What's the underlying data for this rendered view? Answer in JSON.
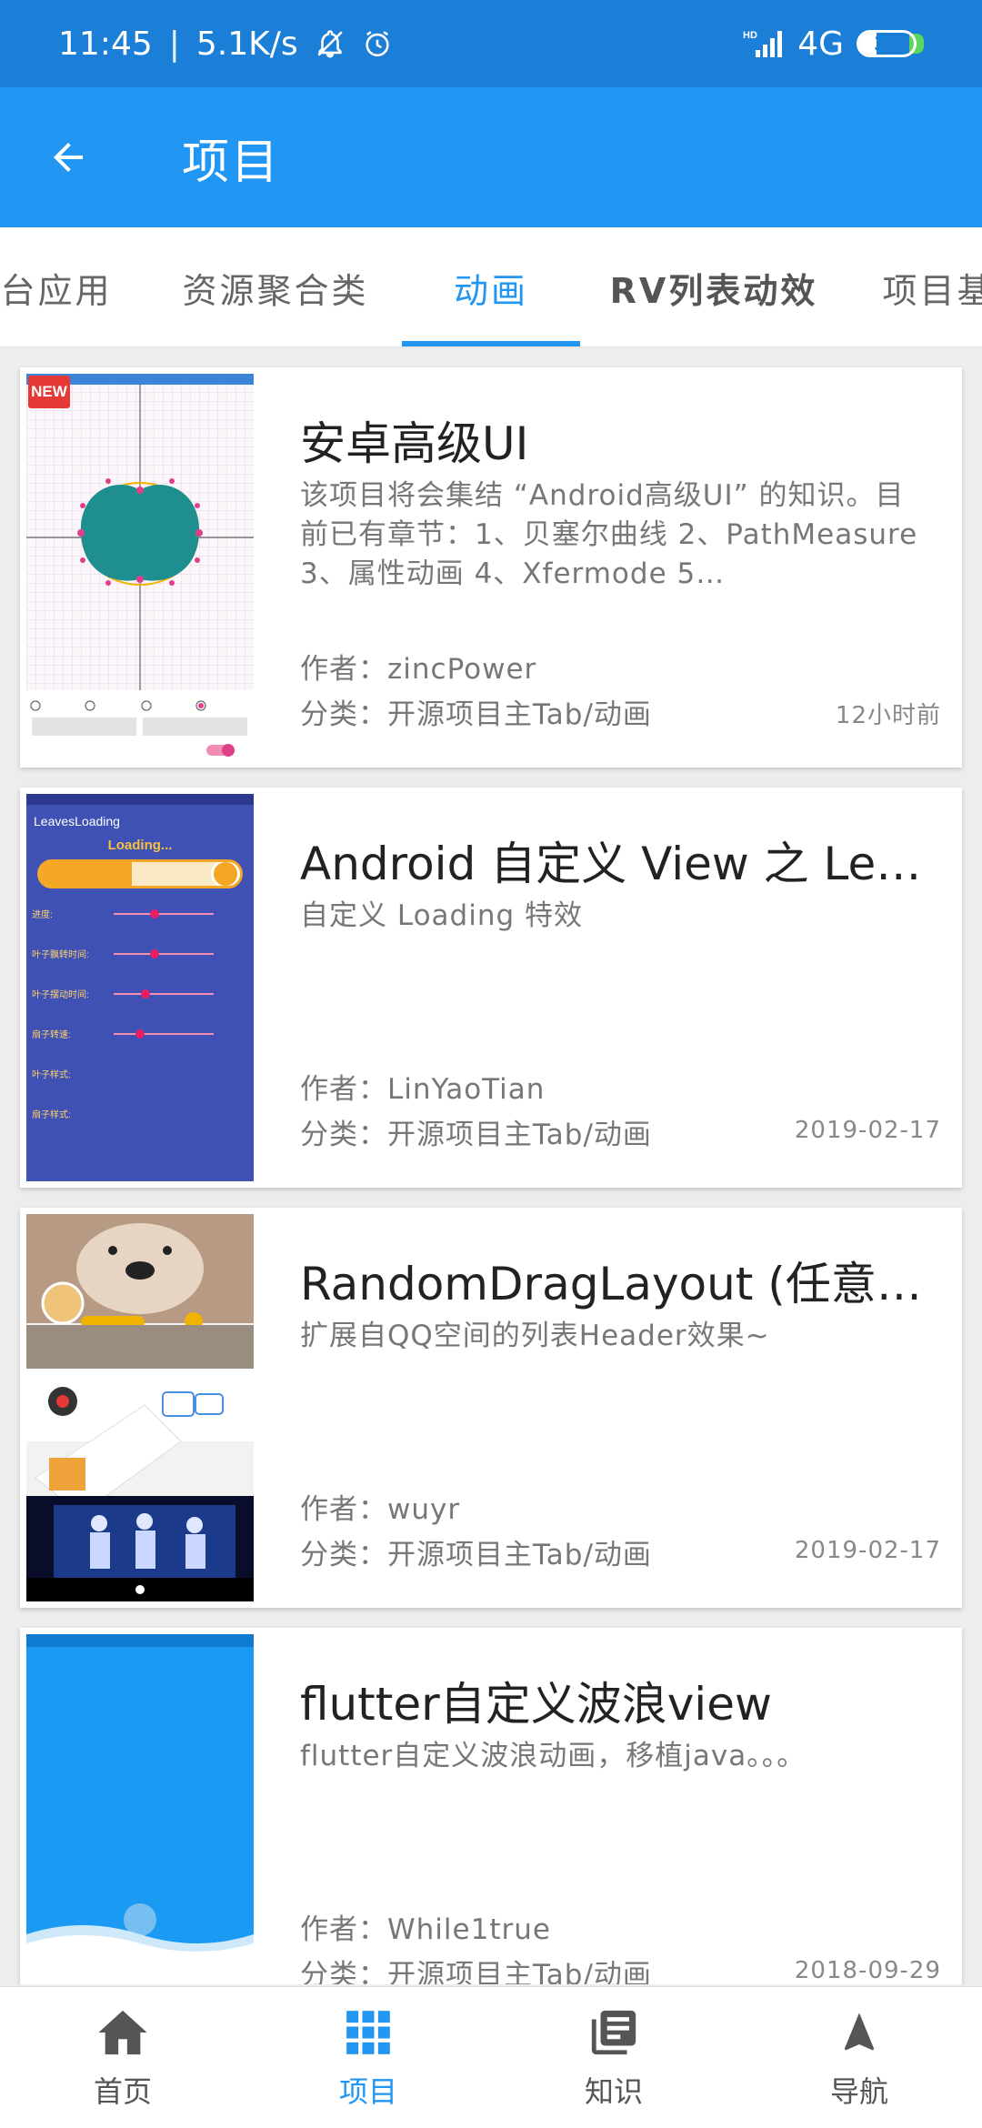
{
  "status_bar": {
    "time": "11:45",
    "speed": "5.1K/s",
    "network": "4G",
    "signal_label": "HD",
    "battery": "31",
    "battery_level": 0.31
  },
  "app_bar": {
    "title": "项目"
  },
  "tabs": [
    {
      "label": "台应用",
      "active": false
    },
    {
      "label": "资源聚合类",
      "active": false
    },
    {
      "label": "动画",
      "active": true
    },
    {
      "label": "RV列表动效",
      "active": false
    },
    {
      "label": "项目基",
      "active": false
    }
  ],
  "projects": [
    {
      "title": "安卓高级UI",
      "desc": "该项目将会集结 “Android高级UI” 的知识。目前已有章节：1、贝塞尔曲线 2、PathMeasure 3、属性动画 4、Xfermode 5…",
      "author": "作者：zincPower",
      "category": "分类：开源项目主Tab/动画",
      "time": "12小时前",
      "is_new": true,
      "new_label": "NEW"
    },
    {
      "title": "Android 自定义 View 之 LeavesLoading",
      "desc": "自定义 Loading 特效",
      "author": "作者：LinYaoTian",
      "category": "分类：开源项目主Tab/动画",
      "time": "2019-02-17",
      "is_new": false,
      "thumb_title": "LeavesLoading",
      "thumb_loading": "Loading...",
      "thumb_rows": [
        "进度:",
        "叶子飘转时间:",
        "叶子摆动时间:",
        "扇子转速:",
        "叶子样式:",
        "扇子样式:"
      ]
    },
    {
      "title": "RandomDragLayout (任意拖拽布局)",
      "desc": "扩展自QQ空间的列表Header效果~",
      "author": "作者：wuyr",
      "category": "分类：开源项目主Tab/动画",
      "time": "2019-02-17",
      "is_new": false
    },
    {
      "title": "flutter自定义波浪view",
      "desc": "flutter自定义波浪动画，移植java。。。",
      "author": "作者：While1true",
      "category": "分类：开源项目主Tab/动画",
      "time": "2018-09-29",
      "is_new": false
    }
  ],
  "bottom_nav": [
    {
      "label": "首页",
      "icon": "home-icon",
      "active": false
    },
    {
      "label": "项目",
      "icon": "grid-icon",
      "active": true
    },
    {
      "label": "知识",
      "icon": "book-icon",
      "active": false
    },
    {
      "label": "导航",
      "icon": "navigation-arrow-icon",
      "active": false
    }
  ],
  "colors": {
    "primary": "#2196f3",
    "status_bar": "#1b7fd8",
    "background": "#ededed"
  }
}
